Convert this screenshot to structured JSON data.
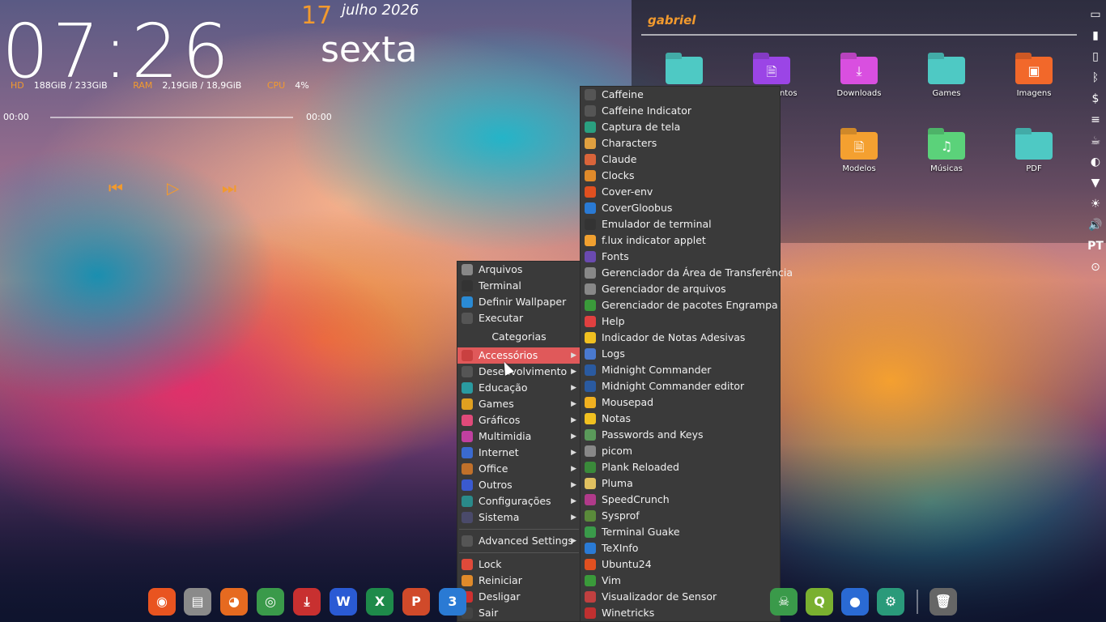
{
  "clock": {
    "time": "07:26",
    "day": "17",
    "month_year": "julho 2026",
    "weekday": "sexta"
  },
  "stats": {
    "hd_label": "HD",
    "hd_value": "188GiB / 233GiB",
    "ram_label": "RAM",
    "ram_value": "2,19GiB / 18,9GiB",
    "cpu_label": "CPU",
    "cpu_value": "4%"
  },
  "player": {
    "elapsed": "00:00",
    "total": "00:00",
    "progress_fraction": 0
  },
  "desktop": {
    "user": "gabriel",
    "folders": [
      {
        "label": "",
        "color": "#4ec9c4",
        "icon": ""
      },
      {
        "label": "Documentos",
        "color": "#9b45e6",
        "icon": "🗎"
      },
      {
        "label": "Downloads",
        "color": "#d94fe0",
        "icon": "⤓"
      },
      {
        "label": "Games",
        "color": "#4ec9c4",
        "icon": ""
      },
      {
        "label": "Imagens",
        "color": "#f2682a",
        "icon": "▣"
      },
      {
        "label": "Modelos",
        "color": "#f4a030",
        "icon": "🗎"
      },
      {
        "label": "Músicas",
        "color": "#5bd27a",
        "icon": "♫"
      },
      {
        "label": "PDF",
        "color": "#4ec9c4",
        "icon": ""
      }
    ]
  },
  "tray": [
    "▭",
    "▮",
    "▯",
    "ᛒ",
    "$",
    "≡",
    "☕",
    "◐",
    "▼",
    "☀",
    "🔊",
    "PT",
    "⊙"
  ],
  "main_menu": {
    "items": [
      {
        "label": "Arquivos",
        "icon": "folder-icon",
        "color": "#888"
      },
      {
        "label": "Terminal",
        "icon": "terminal-icon",
        "color": "#333"
      },
      {
        "label": "Definir Wallpaper",
        "icon": "wallpaper-icon",
        "color": "#2a8ad4"
      },
      {
        "label": "Executar",
        "icon": "gears-icon",
        "color": "#555"
      }
    ],
    "categories_header": "Categorias",
    "categories": [
      {
        "label": "Accessórios",
        "color": "#c94040",
        "active": true
      },
      {
        "label": "Desenvolvimento",
        "color": "#555",
        "active": false
      },
      {
        "label": "Educação",
        "color": "#2a9aa0",
        "active": false
      },
      {
        "label": "Games",
        "color": "#e0a020",
        "active": false
      },
      {
        "label": "Gráficos",
        "color": "#e04a7a",
        "active": false
      },
      {
        "label": "Multimidia",
        "color": "#c040a0",
        "active": false
      },
      {
        "label": "Internet",
        "color": "#3a6ad0",
        "active": false
      },
      {
        "label": "Office",
        "color": "#c0702a",
        "active": false
      },
      {
        "label": "Outros",
        "color": "#3a5ad0",
        "active": false
      },
      {
        "label": "Configurações",
        "color": "#2a8a8a",
        "active": false
      },
      {
        "label": "Sistema",
        "color": "#4a4a6a",
        "active": false
      }
    ],
    "advanced": "Advanced Settings",
    "actions": [
      {
        "label": "Lock",
        "color": "#e04a3a"
      },
      {
        "label": "Reiniciar",
        "color": "#e08a2a"
      },
      {
        "label": "Desligar",
        "color": "#d03030"
      },
      {
        "label": "Sair",
        "color": "#444"
      }
    ]
  },
  "submenu": {
    "items": [
      {
        "label": "Caffeine",
        "color": "#555"
      },
      {
        "label": "Caffeine Indicator",
        "color": "#555"
      },
      {
        "label": "Captura de tela",
        "color": "#2aa080"
      },
      {
        "label": "Characters",
        "color": "#e0a040"
      },
      {
        "label": "Claude",
        "color": "#d9643a"
      },
      {
        "label": "Clocks",
        "color": "#e08a2a"
      },
      {
        "label": "Cover-env",
        "color": "#e05020"
      },
      {
        "label": "CoverGloobus",
        "color": "#2a7ad4"
      },
      {
        "label": "Emulador de terminal",
        "color": "#333"
      },
      {
        "label": "f.lux indicator applet",
        "color": "#f0a030"
      },
      {
        "label": "Fonts",
        "color": "#6a4ab0"
      },
      {
        "label": "Gerenciador da Área de Transferência",
        "color": "#888"
      },
      {
        "label": "Gerenciador de arquivos",
        "color": "#888"
      },
      {
        "label": "Gerenciador de pacotes Engrampa",
        "color": "#3a9a3a"
      },
      {
        "label": "Help",
        "color": "#e04040"
      },
      {
        "label": "Indicador de Notas Adesivas",
        "color": "#f0c020"
      },
      {
        "label": "Logs",
        "color": "#4a7ad0"
      },
      {
        "label": "Midnight Commander",
        "color": "#2a5aa0"
      },
      {
        "label": "Midnight Commander editor",
        "color": "#2a5aa0"
      },
      {
        "label": "Mousepad",
        "color": "#f0b020"
      },
      {
        "label": "Notas",
        "color": "#f0c020"
      },
      {
        "label": "Passwords and Keys",
        "color": "#5a9a5a"
      },
      {
        "label": "picom",
        "color": "#888"
      },
      {
        "label": "Plank Reloaded",
        "color": "#3a8a3a"
      },
      {
        "label": "Pluma",
        "color": "#e0c060"
      },
      {
        "label": "SpeedCrunch",
        "color": "#b03a8a"
      },
      {
        "label": "Sysprof",
        "color": "#5a8a3a"
      },
      {
        "label": "Terminal Guake",
        "color": "#3a9a4a"
      },
      {
        "label": "TeXInfo",
        "color": "#2a7ad4"
      },
      {
        "label": "Ubuntu24",
        "color": "#e05020"
      },
      {
        "label": "Vim",
        "color": "#3a9a3a"
      },
      {
        "label": "Visualizador de Sensor",
        "color": "#c04040"
      },
      {
        "label": "Winetricks",
        "color": "#c03030"
      }
    ]
  },
  "dock": [
    {
      "icon": "ubuntu-icon",
      "glyph": "◉",
      "color": "#e95420"
    },
    {
      "icon": "files-icon",
      "glyph": "▤",
      "color": "#8a8a8a"
    },
    {
      "icon": "firefox-icon",
      "glyph": "◕",
      "color": "#e66a20"
    },
    {
      "icon": "chrome-icon",
      "glyph": "◎",
      "color": "#3a9a4a"
    },
    {
      "icon": "installer-icon",
      "glyph": "⤓",
      "color": "#c83030"
    },
    {
      "icon": "word-icon",
      "glyph": "W",
      "color": "#2a5ad4"
    },
    {
      "icon": "excel-icon",
      "glyph": "X",
      "color": "#1e8a4a"
    },
    {
      "icon": "powerpoint-icon",
      "glyph": "P",
      "color": "#d04a2a"
    },
    {
      "icon": "app-3-icon",
      "glyph": "3",
      "color": "#2a7ad4"
    },
    {
      "icon": "guake-icon",
      "glyph": "☠",
      "color": "#3a9a4a"
    },
    {
      "icon": "qgis-icon",
      "glyph": "Q",
      "color": "#7ab030"
    },
    {
      "icon": "globe-icon",
      "glyph": "●",
      "color": "#2a6ad4"
    },
    {
      "icon": "settings-icon",
      "glyph": "⚙",
      "color": "#2a9a7a"
    },
    {
      "icon": "trash-icon",
      "glyph": "🗑",
      "color": "#666"
    }
  ]
}
